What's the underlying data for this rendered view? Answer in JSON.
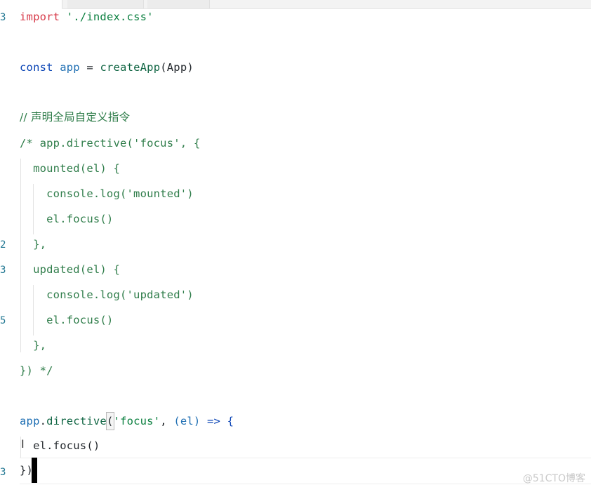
{
  "editor": {
    "line_numbers": [
      "3",
      "",
      "",
      "",
      "",
      "",
      "",
      "",
      "",
      "2",
      "3",
      "",
      "5",
      "",
      "",
      "",
      "",
      "",
      "3",
      ""
    ],
    "lines": [
      [
        {
          "t": "import",
          "c": "#d73a49"
        },
        {
          "t": " ",
          "c": "#24292e"
        },
        {
          "t": "'./index.css'",
          "c": "#0a7f3f"
        }
      ],
      [
        {
          "t": "const",
          "c": "#0a44b5"
        },
        {
          "t": " ",
          "c": "#24292e"
        },
        {
          "t": "app",
          "c": "#1f6fb3"
        },
        {
          "t": " = ",
          "c": "#24292e"
        },
        {
          "t": "createApp",
          "c": "#116644"
        },
        {
          "t": "(App)",
          "c": "#24292e"
        }
      ],
      [
        {
          "t": "// 声明全局自定义指令",
          "c": "#2f7d4a",
          "cjk": true
        }
      ],
      [
        {
          "t": "/* app.directive('focus', {",
          "c": "#2f7d4a"
        }
      ],
      [
        {
          "t": "  mounted(el) {",
          "c": "#2f7d4a"
        }
      ],
      [
        {
          "t": "    console.log('mounted')",
          "c": "#2f7d4a"
        }
      ],
      [
        {
          "t": "    el.focus()",
          "c": "#2f7d4a"
        }
      ],
      [
        {
          "t": "  },",
          "c": "#2f7d4a"
        }
      ],
      [
        {
          "t": "  updated(el) {",
          "c": "#2f7d4a"
        }
      ],
      [
        {
          "t": "    console.log('updated')",
          "c": "#2f7d4a"
        }
      ],
      [
        {
          "t": "    el.focus()",
          "c": "#2f7d4a"
        }
      ],
      [
        {
          "t": "  },",
          "c": "#2f7d4a"
        }
      ],
      [
        {
          "t": "}) */",
          "c": "#2f7d4a"
        }
      ],
      [
        {
          "t": "app",
          "c": "#1f6fb3"
        },
        {
          "t": ".",
          "c": "#24292e"
        },
        {
          "t": "directive",
          "c": "#116644"
        },
        {
          "t": "(",
          "c": "#24292e",
          "match": true
        },
        {
          "t": "'focus'",
          "c": "#0a7f3f"
        },
        {
          "t": ", ",
          "c": "#24292e"
        },
        {
          "t": "(el)",
          "c": "#1f6fb3"
        },
        {
          "t": " => {",
          "c": "#0a44b5"
        }
      ],
      [
        {
          "t": "  el.focus()",
          "c": "#24292e"
        }
      ],
      [
        {
          "t": "})",
          "c": "#24292e"
        }
      ]
    ]
  },
  "watermark": "@51CTO博客"
}
